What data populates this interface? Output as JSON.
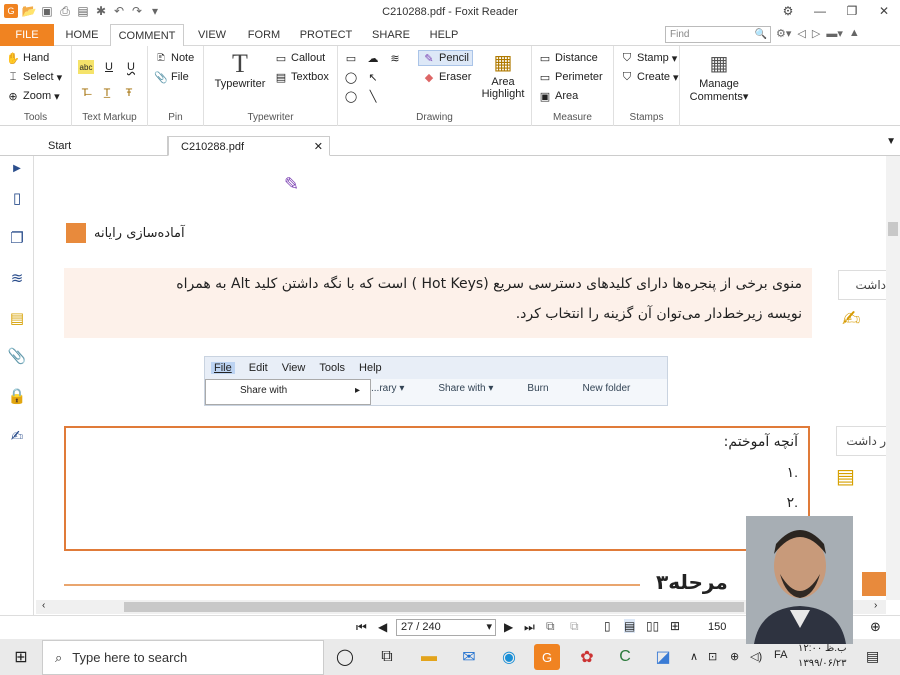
{
  "window": {
    "title": "C210288.pdf - Foxit Reader",
    "min": "—",
    "max": "❐",
    "close": "✕",
    "extra": "⚙"
  },
  "menu": {
    "file": "FILE",
    "home": "HOME",
    "comment": "COMMENT",
    "view": "VIEW",
    "form": "FORM",
    "protect": "PROTECT",
    "share": "SHARE",
    "help": "HELP",
    "find_placeholder": "Find"
  },
  "ribbon": {
    "tools": {
      "label": "Tools",
      "hand": "Hand",
      "select": "Select",
      "zoom": "Zoom"
    },
    "text_markup": {
      "label": "Text Markup"
    },
    "pin": {
      "label": "Pin",
      "note": "Note",
      "file": "File"
    },
    "typewriter": {
      "label": "Typewriter",
      "typewriter": "Typewriter",
      "callout": "Callout",
      "textbox": "Textbox"
    },
    "drawing": {
      "label": "Drawing",
      "pencil": "Pencil",
      "eraser": "Eraser",
      "area_highlight_1": "Area",
      "area_highlight_2": "Highlight"
    },
    "measure": {
      "label": "Measure",
      "distance": "Distance",
      "perimeter": "Perimeter",
      "area": "Area"
    },
    "stamps": {
      "label": "Stamps",
      "stamp": "Stamp",
      "create": "Create"
    },
    "manage": {
      "l1": "Manage",
      "l2": "Comments"
    }
  },
  "tabs": {
    "start": "Start",
    "doc": "C210288.pdf",
    "close": "✕"
  },
  "doc": {
    "header": "آماده‌سازی رایانه",
    "para1": "منوی برخی از پنجره‌ها دارای کلیدهای  دسترسی سریع (Hot Keys ) است که با نگه داشتن کلید Alt به همراه",
    "para2": "نویسه زیرخط‌دار می‌توان آن گزینه را انتخاب کرد.",
    "screenshot": {
      "menu": [
        "File",
        "Edit",
        "View",
        "Tools",
        "Help"
      ],
      "item": "Share with",
      "tb": [
        "...rary ▾",
        "Share with ▾",
        "Burn",
        "New folder"
      ]
    },
    "box_title": "آنچه آموختم:",
    "box_items": [
      "۱.",
      "۲."
    ],
    "step": "مرحله۳",
    "side_note1": "داشت",
    "side_note2": "ر داشت"
  },
  "status": {
    "page": "27 / 240",
    "zoom": "150"
  },
  "taskbar": {
    "search": "Type here to search",
    "time": "۱۲:۰۰ ب.ظ",
    "date": "۱۳۹۹/۰۶/۲۳",
    "lang": "FA"
  },
  "colors": {
    "accent": "#f08321",
    "docbox": "#e07b39",
    "para_bg": "#fdf1ea"
  }
}
